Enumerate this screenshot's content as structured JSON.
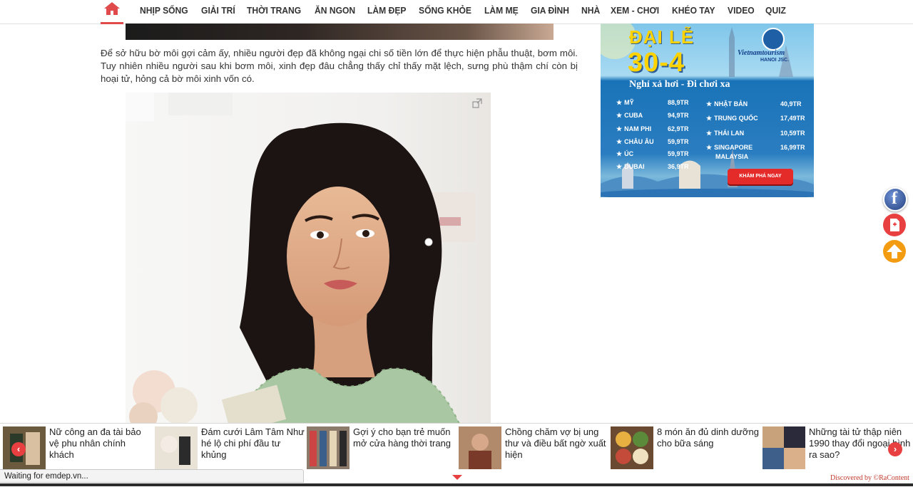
{
  "nav": {
    "items": [
      "NHỊP SỐNG",
      "GIẢI TRÍ",
      "THỜI TRANG",
      "ĂN NGON",
      "LÀM ĐẸP",
      "SỐNG KHỎE",
      "LÀM MẸ",
      "GIA ĐÌNH",
      "NHÀ",
      "XEM - CHƠI",
      "KHÉO TAY",
      "VIDEO",
      "QUIZ"
    ],
    "accent": "#e04a4a"
  },
  "article": {
    "paragraph": "Để sở hữu bờ môi gợi cảm ấy, nhiều người đẹp đã không ngại chi số tiền lớn để thực hiện phẫu thuật, bơm môi. Tuy nhiên nhiều người sau khi bơm môi, xinh đẹp đâu chẳng thấy chỉ thấy mặt lệch, sưng phù thậm chí còn bị hoại tử, hỏng cả bờ môi xinh vốn có."
  },
  "ad": {
    "headline": "ĐẠI LỄ",
    "date": "30-4",
    "tagline": "Nghỉ xả hơi - Đi chơi xa",
    "brand": "Vietnamtourism",
    "brand_sub": "HANOI JSC.",
    "destinations_left": [
      {
        "name": "MỸ",
        "price": "88,9TR"
      },
      {
        "name": "CUBA",
        "price": "94,9TR"
      },
      {
        "name": "NAM PHI",
        "price": "62,9TR"
      },
      {
        "name": "CHÂU ÂU",
        "price": "59,9TR"
      },
      {
        "name": "ÚC",
        "price": "59,9TR"
      },
      {
        "name": "DUBAI",
        "price": "36,9TR"
      }
    ],
    "destinations_right": [
      {
        "name": "NHẬT BẢN",
        "price": "40,9TR"
      },
      {
        "name": "TRUNG QUỐC",
        "price": "17,49TR"
      },
      {
        "name": "THÁI LAN",
        "price": "10,59TR"
      },
      {
        "name": "SINGAPORE",
        "price": "16,99TR"
      },
      {
        "name": "MALAYSIA",
        "price": ""
      }
    ],
    "cta": "KHÁM PHÁ NGAY"
  },
  "recommendations": [
    {
      "title": "Nữ công an đa tài bảo vệ phu nhân chính khách"
    },
    {
      "title": "Đám cưới Lâm Tâm Như hé lộ chi phí đầu tư khủng"
    },
    {
      "title": "Gợi ý cho bạn trẻ muốn mở cửa hàng thời trang"
    },
    {
      "title": "Chồng chăm vợ bị ung thư và điều bất ngờ xuất hiện"
    },
    {
      "title": "8 món ăn đủ dinh dưỡng cho bữa sáng"
    },
    {
      "title": "Những tài tử thập niên 1990 thay đổi ngoại hình ra sao?"
    }
  ],
  "discovered": "Discovered by ©RaContent",
  "status": "Waiting for emdep.vn..."
}
